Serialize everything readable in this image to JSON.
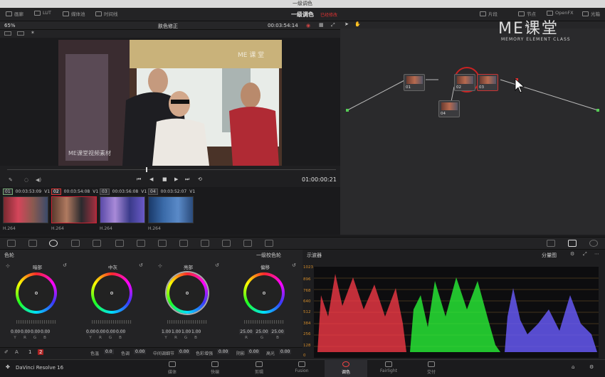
{
  "window": {
    "title": "一级调色"
  },
  "topbar": {
    "left_buttons": [
      {
        "label": "画廊",
        "icon": "gallery-icon"
      },
      {
        "label": "LUT",
        "icon": "lut-icon"
      },
      {
        "label": "媒体池",
        "icon": "media-pool-icon"
      },
      {
        "label": "时间线",
        "icon": "timeline-icon"
      }
    ],
    "page_title": "一级调色",
    "page_subtitle": "已经修改",
    "right_buttons": [
      {
        "label": "片段",
        "icon": "clips-icon"
      },
      {
        "label": "节点",
        "icon": "nodes-icon"
      },
      {
        "label": "OpenFX",
        "icon": "openfx-icon"
      },
      {
        "label": "光箱",
        "icon": "lightbox-icon"
      }
    ]
  },
  "viewer": {
    "zoom": "65%",
    "clip_name": "肤色修正",
    "timecode": "00:03:54:14",
    "transport_timecode": "01:00:00:21",
    "watermark_top": "ME 课 堂",
    "watermark_bottom": "ME课堂视频素材"
  },
  "node_editor": {
    "mode": "片段",
    "nodes": [
      {
        "label": "01"
      },
      {
        "label": "02"
      },
      {
        "label": "03"
      },
      {
        "label": "04"
      }
    ]
  },
  "brand": {
    "logo": "ME课堂",
    "tagline": "MEMORY ELEMENT CLASS"
  },
  "clips": [
    {
      "num": "01",
      "tc": "00:03:53:09",
      "track": "V1",
      "codec": "H.264"
    },
    {
      "num": "02",
      "tc": "00:03:54:08",
      "track": "V1",
      "codec": "H.264"
    },
    {
      "num": "03",
      "tc": "00:03:56:08",
      "track": "V1",
      "codec": "H.264"
    },
    {
      "num": "04",
      "tc": "00:03:52:07",
      "track": "V1",
      "codec": "H.264"
    }
  ],
  "color_wheels": {
    "panel_title": "色轮",
    "mode": "一级校色轮",
    "wheels": [
      {
        "title": "暗部",
        "values": [
          "0.00",
          "0.00",
          "0.00",
          "0.00"
        ],
        "labels": [
          "Y",
          "R",
          "G",
          "B"
        ]
      },
      {
        "title": "中灰",
        "values": [
          "0.00",
          "0.00",
          "0.00",
          "0.00"
        ],
        "labels": [
          "Y",
          "R",
          "G",
          "B"
        ]
      },
      {
        "title": "亮部",
        "values": [
          "1.00",
          "1.00",
          "1.00",
          "1.00"
        ],
        "labels": [
          "Y",
          "R",
          "G",
          "B"
        ]
      },
      {
        "title": "偏移",
        "values": [
          "25.00",
          "25.00",
          "25.00"
        ],
        "labels": [
          "R",
          "G",
          "B"
        ]
      }
    ],
    "page_tabs": [
      "1",
      "2"
    ]
  },
  "adjustments": [
    {
      "label": "色温",
      "value": "0.0"
    },
    {
      "label": "色调",
      "value": "0.00"
    },
    {
      "label": "中间调细节",
      "value": "0.00"
    },
    {
      "label": "色彩增强",
      "value": "0.00"
    },
    {
      "label": "阴影",
      "value": "0.00"
    },
    {
      "label": "高光",
      "value": "0.00"
    }
  ],
  "scope": {
    "title": "示波器",
    "mode": "分量图",
    "y_ticks": [
      "1023",
      "896",
      "768",
      "640",
      "512",
      "384",
      "256",
      "128",
      "0"
    ]
  },
  "bottom": {
    "app_name": "DaVinci Resolve 16",
    "tabs": [
      {
        "label": "媒体",
        "icon": "media-icon"
      },
      {
        "label": "快编",
        "icon": "cut-icon"
      },
      {
        "label": "剪辑",
        "icon": "edit-icon"
      },
      {
        "label": "Fusion",
        "icon": "fusion-icon"
      },
      {
        "label": "调色",
        "icon": "color-icon"
      },
      {
        "label": "Fairlight",
        "icon": "fairlight-icon"
      },
      {
        "label": "交付",
        "icon": "deliver-icon"
      }
    ]
  },
  "colors": {
    "accent_red": "#d33333",
    "scope_red": "#ff3b4a",
    "scope_green": "#29ff3a",
    "scope_blue": "#6a5cff"
  }
}
